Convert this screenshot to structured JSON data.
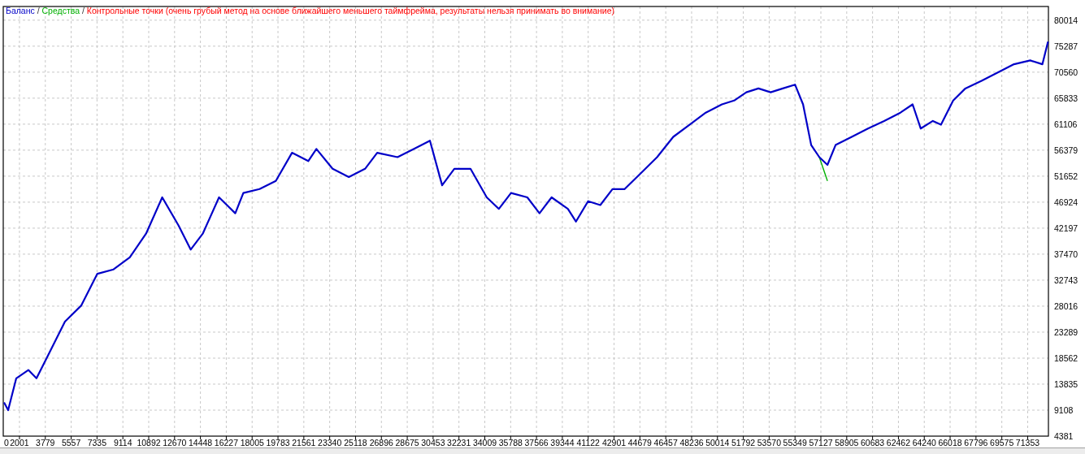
{
  "graph": {
    "separators": [
      "/",
      "/"
    ],
    "note": {
      "label": "Контрольные точки (очень грубый метод на основе ближайшего меньшего таймфрейма, результаты нельзя принимать во внимание)",
      "color": "#ff0000"
    },
    "x_origin_label": "0",
    "chart_data": {
      "type": "line",
      "grid": true,
      "x": [
        941,
        1220,
        1778,
        2615,
        3173,
        4010,
        5126,
        6242,
        7358,
        8474,
        9590,
        10706,
        11822,
        12938,
        13775,
        14612,
        15728,
        16844,
        17402,
        18518,
        19634,
        20750,
        21866,
        22424,
        23540,
        24656,
        25772,
        26609,
        28004,
        29120,
        30236,
        31073,
        31910,
        33026,
        34142,
        34979,
        35816,
        36932,
        37769,
        38606,
        39722,
        40280,
        41117,
        41954,
        42791,
        43628,
        44744,
        45860,
        46976,
        48092,
        49208,
        50324,
        51161,
        51998,
        52835,
        53672,
        54509,
        55346,
        55904,
        56462,
        57020,
        57578,
        58136,
        59252,
        60368,
        61484,
        62600,
        63437,
        63995,
        64832,
        65390,
        66227,
        67064,
        68180,
        69296,
        70412,
        71528,
        72365,
        72752
      ],
      "series": [
        {
          "name": "Баланс",
          "color": "#0000c8",
          "values": [
            10500,
            9100,
            14900,
            16400,
            14900,
            19300,
            25200,
            28100,
            33900,
            34700,
            36900,
            41200,
            47800,
            42700,
            38300,
            41200,
            47800,
            44900,
            48600,
            49300,
            50800,
            55900,
            54400,
            56600,
            53000,
            51500,
            53000,
            55900,
            55100,
            56600,
            58100,
            50000,
            53000,
            53000,
            47800,
            45700,
            48600,
            47800,
            44900,
            47800,
            45700,
            43400,
            47100,
            46400,
            49300,
            49300,
            52200,
            55100,
            58800,
            61000,
            63200,
            64700,
            65400,
            66900,
            67600,
            66900,
            67600,
            68300,
            64700,
            57300,
            55100,
            53700,
            57300,
            58800,
            60300,
            61700,
            63200,
            64700,
            60300,
            61700,
            61000,
            65400,
            67600,
            69000,
            70500,
            72000,
            72700,
            72000,
            76100
          ]
        },
        {
          "name": "Средства",
          "color": "#00b000",
          "values": [
            null,
            null,
            null,
            null,
            null,
            null,
            null,
            null,
            null,
            null,
            null,
            null,
            null,
            null,
            null,
            null,
            null,
            null,
            null,
            null,
            null,
            null,
            null,
            null,
            null,
            null,
            null,
            null,
            null,
            null,
            null,
            null,
            null,
            null,
            null,
            null,
            null,
            null,
            null,
            null,
            null,
            null,
            null,
            null,
            null,
            null,
            null,
            null,
            null,
            null,
            null,
            null,
            null,
            null,
            null,
            null,
            null,
            null,
            null,
            null,
            55100,
            50800,
            null,
            null,
            null,
            null,
            null,
            null,
            null,
            null,
            null,
            null,
            null,
            null,
            null,
            null,
            null,
            null,
            null
          ]
        }
      ],
      "xlim": [
        885,
        72780
      ],
      "ylim": [
        4381,
        82500
      ],
      "xticks": [
        2001,
        3779,
        5557,
        7335,
        9114,
        10892,
        12670,
        14448,
        16227,
        18005,
        19783,
        21561,
        23340,
        25118,
        26896,
        28675,
        30453,
        32231,
        34009,
        35788,
        37566,
        39344,
        41122,
        42901,
        44679,
        46457,
        48236,
        50014,
        51792,
        53570,
        55349,
        57127,
        58905,
        60683,
        62462,
        64240,
        66018,
        67796,
        69575,
        71353
      ],
      "yticks": [
        4381,
        9108,
        13835,
        18562,
        23289,
        28016,
        32743,
        37470,
        42197,
        46924,
        51652,
        56379,
        61106,
        65833,
        70560,
        75287,
        80014
      ]
    }
  }
}
